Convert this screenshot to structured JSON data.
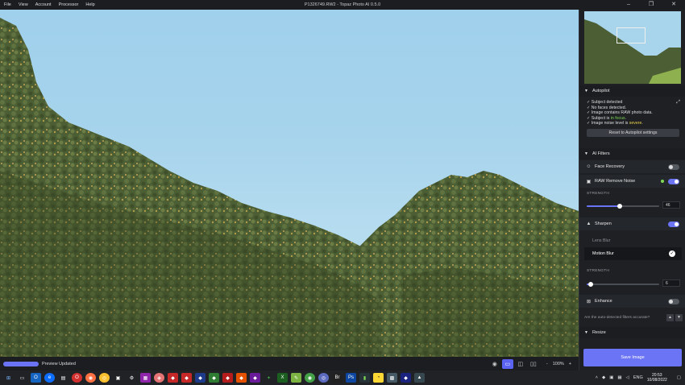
{
  "titlebar": {
    "menu": [
      "File",
      "View",
      "Account",
      "Processor",
      "Help"
    ],
    "title": "P1326749.RW2 - Topaz Photo AI 0.5.0"
  },
  "status": {
    "progress_label": "Preview Updated",
    "zoom": "100%",
    "zoom_minus": "-",
    "zoom_plus": "+"
  },
  "autopilot": {
    "title": "Autopilot",
    "lines": [
      {
        "prefix": "✓ ",
        "text": "Subject detected",
        "highlight": "",
        "suffix": ""
      },
      {
        "prefix": "✓ ",
        "text": "No faces detected.",
        "highlight": "",
        "suffix": ""
      },
      {
        "prefix": "✓ ",
        "text": "Image contains RAW photo data.",
        "highlight": "",
        "suffix": ""
      },
      {
        "prefix": "✓ ",
        "text": "Subject is ",
        "highlight": "in focus",
        "suffix": "."
      },
      {
        "prefix": "✓ ",
        "text": "Image noise level is ",
        "highlight": "severe",
        "suffix": "."
      }
    ],
    "reset_label": "Reset to Autopilot settings"
  },
  "filters": {
    "title": "AI Filters",
    "face_recovery": {
      "label": "Face Recovery",
      "enabled": false
    },
    "raw_remove_noise": {
      "label": "RAW Remove Noise",
      "enabled": true,
      "strength_label": "STRENGTH",
      "strength": 46
    },
    "sharpen": {
      "label": "Sharpen",
      "enabled": true,
      "options": [
        "Lens Blur",
        "Motion Blur"
      ],
      "selected": "Motion Blur",
      "strength_label": "STRENGTH",
      "strength": 6
    },
    "enhance": {
      "label": "Enhance",
      "enabled": false
    },
    "accuracy_prompt": "Are the auto-detected filters accurate?"
  },
  "resize": {
    "title": "Resize"
  },
  "save_label": "Save Image",
  "taskbar": {
    "time": "20:53",
    "date": "10/08/2022",
    "tray_lang": "ENG"
  },
  "colors": {
    "accent": "#6b74f5",
    "ok": "#7ed957",
    "warn": "#f0d24a",
    "panel_bg": "#1e2024"
  }
}
